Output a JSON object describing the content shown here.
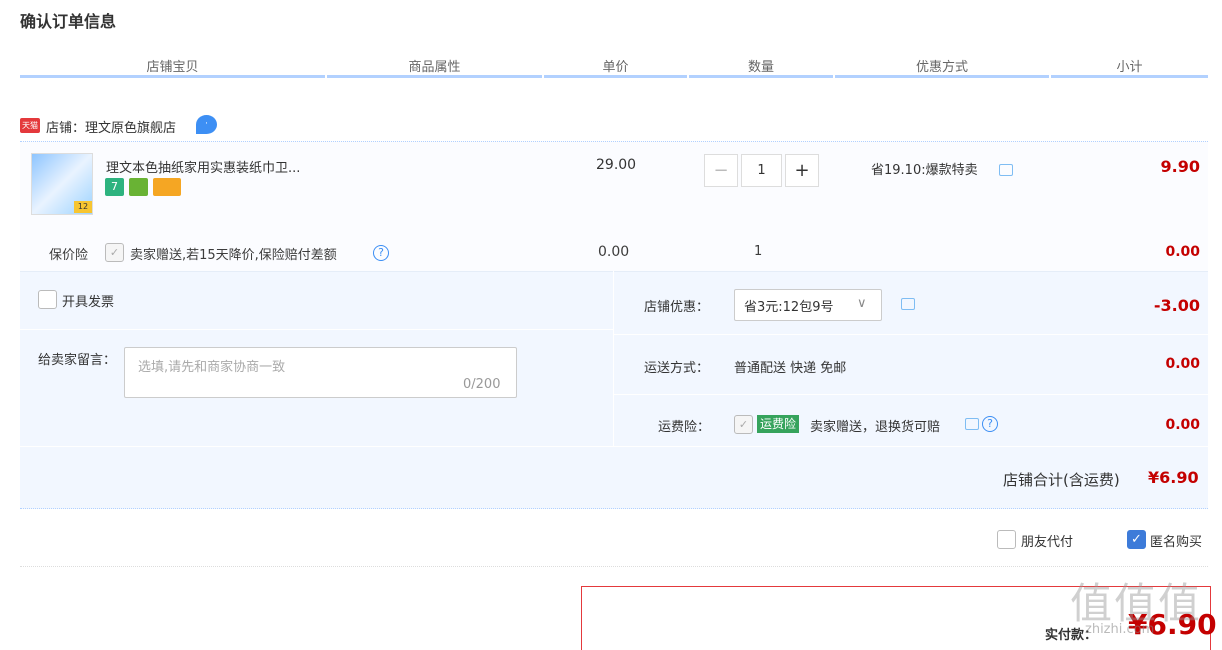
{
  "page_title": "确认订单信息",
  "columns": [
    "店铺宝贝",
    "商品属性",
    "单价",
    "数量",
    "优惠方式",
    "小计"
  ],
  "shop": {
    "tmall_tag": "天猫",
    "label": "店铺：理文原色旗舰店"
  },
  "item": {
    "title": "理文本色抽纸家用实惠装纸巾卫...",
    "thumb_tag": "12",
    "badges": [
      "7",
      "",
      ""
    ],
    "price": "29.00",
    "qty_minus": "−",
    "qty": "1",
    "qty_plus": "+",
    "promo": "省19.10:爆款特卖",
    "subtotal": "9.90"
  },
  "insurance": {
    "label": "保价险",
    "check": "✓",
    "desc": "卖家赠送,若15天降价,保险赔付差额",
    "help": "?",
    "price": "0.00",
    "qty": "1",
    "subtotal": "0.00"
  },
  "invoice_label": "开具发票",
  "message": {
    "label": "给卖家留言：",
    "placeholder": "选填,请先和商家协商一致",
    "count": "0/200"
  },
  "shop_discount": {
    "label": "店铺优惠：",
    "value": "省3元:12包9号",
    "arrow": "∨",
    "amount": "-3.00"
  },
  "shipping": {
    "label": "运送方式：",
    "value": "普通配送 快递 免邮",
    "amount": "0.00"
  },
  "freight_ins": {
    "label": "运费险：",
    "check": "✓",
    "badge": "运费险",
    "desc": "卖家赠送，退换货可赔",
    "help": "?",
    "amount": "0.00"
  },
  "shop_total": {
    "label": "店铺合计(含运费)",
    "value": "¥6.90"
  },
  "options": {
    "friend_pay": "朋友代付",
    "anonymous": "匿名购买",
    "anon_check": "✓"
  },
  "pay": {
    "label": "实付款：",
    "value": "¥6.90"
  },
  "watermark": {
    "text": "值值值",
    "sub": "zhizhi.com"
  }
}
